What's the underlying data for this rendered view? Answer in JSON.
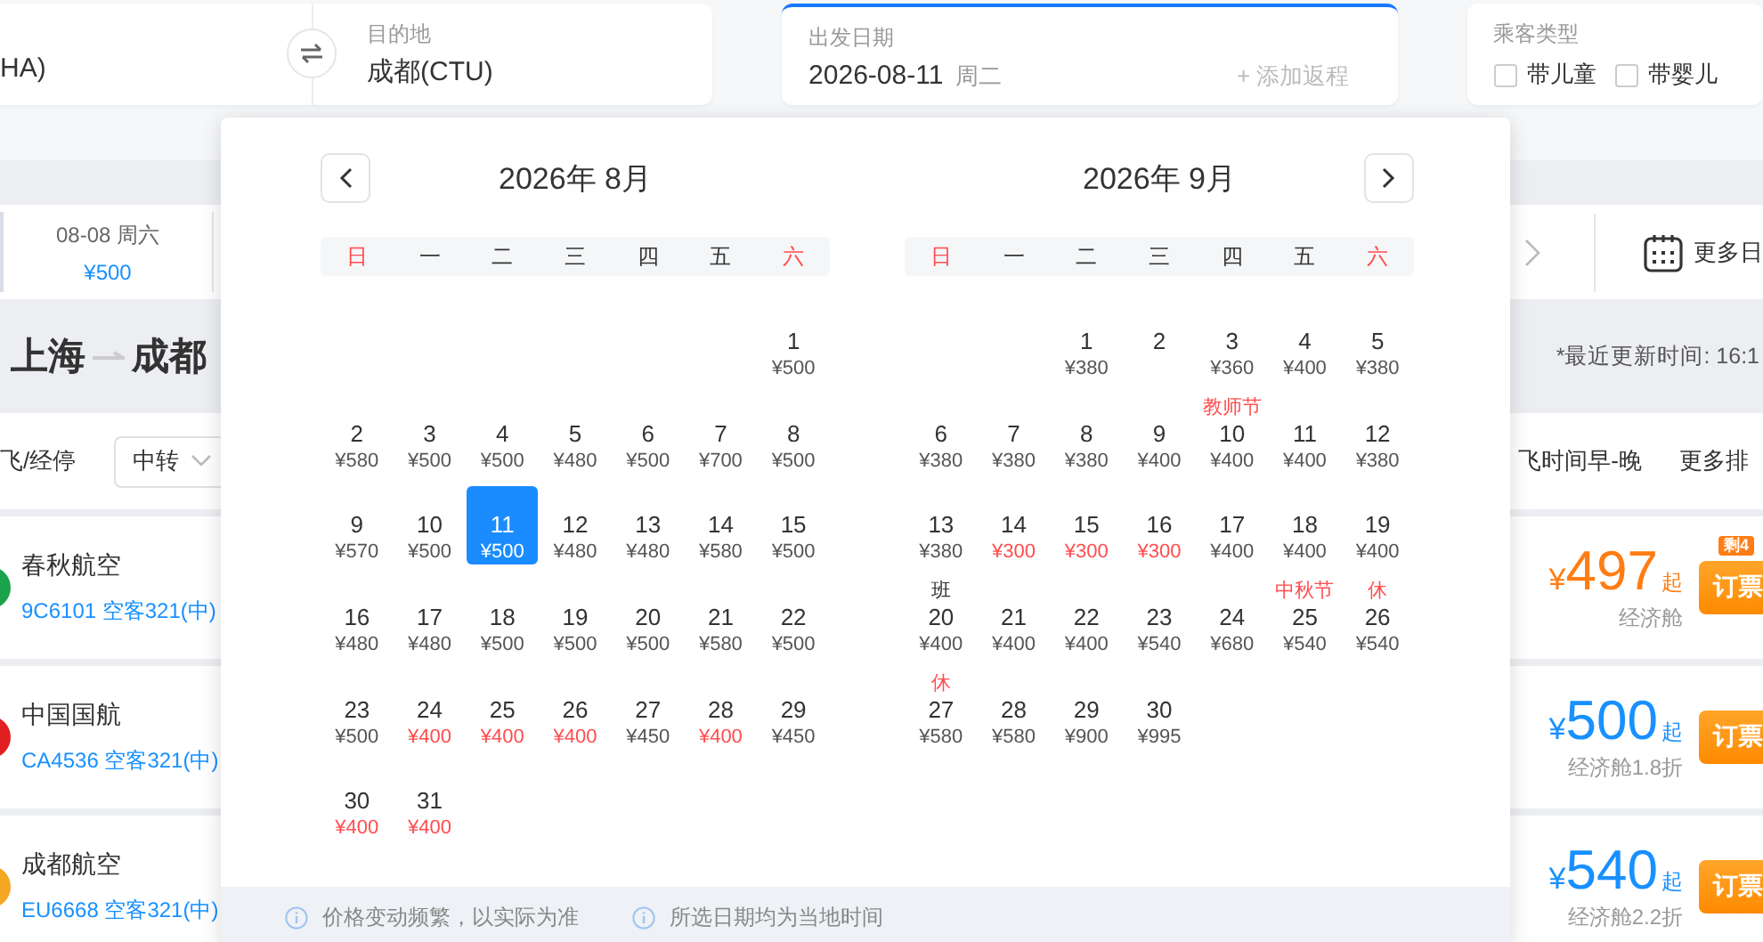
{
  "search": {
    "origin": {
      "value": "HA)"
    },
    "destination": {
      "label": "目的地",
      "value": "成都(CTU)"
    },
    "date": {
      "label": "出发日期",
      "value": "2026-08-11",
      "weekday": "周二",
      "focused": true,
      "add_return": "+ 添加返程"
    },
    "passengers": {
      "label": "乘客类型",
      "options": [
        {
          "label": "带儿童",
          "checked": false
        },
        {
          "label": "带婴儿",
          "checked": false
        }
      ]
    }
  },
  "date_strip": {
    "items": [
      {
        "date": "08-08",
        "weekday": "周六",
        "price": "¥500"
      }
    ],
    "more_dates": "更多日"
  },
  "route": {
    "from": "上海",
    "to": "成都",
    "updated": "*最近更新时间: 16:1"
  },
  "filters": {
    "stops": "飞/经停",
    "transfer": "中转",
    "sort": "飞时间早-晚",
    "more_sort": "更多排"
  },
  "flights": [
    {
      "airline": "春秋航空",
      "color": "#1aa34a",
      "flight": "9C6101 空客321(中)",
      "currency": "¥",
      "price": "497",
      "suffix": "起",
      "cabin": "经济舱",
      "lowest": true,
      "badge": "剩4",
      "book": "订票"
    },
    {
      "airline": "中国国航",
      "color": "#e02020",
      "flight": "CA4536 空客321(中)",
      "currency": "¥",
      "price": "500",
      "suffix": "起",
      "cabin": "经济舱1.8折",
      "lowest": false,
      "book": "订票"
    },
    {
      "airline": "成都航空",
      "color": "#f5a623",
      "flight": "EU6668 空客321(中)",
      "currency": "¥",
      "price": "540",
      "suffix": "起",
      "cabin": "经济舱2.2折",
      "lowest": false,
      "book": "订票"
    }
  ],
  "calendar": {
    "months": [
      {
        "title": "2026年 8月",
        "weekdays": [
          {
            "label": "日",
            "weekend": true
          },
          {
            "label": "一",
            "weekend": false
          },
          {
            "label": "二",
            "weekend": false
          },
          {
            "label": "三",
            "weekend": false
          },
          {
            "label": "四",
            "weekend": false
          },
          {
            "label": "五",
            "weekend": false
          },
          {
            "label": "六",
            "weekend": true
          }
        ],
        "weeks": [
          {
            "first_week": true,
            "days": [
              {
                "day": "1",
                "price": "¥500",
                "low": false,
                "selected": false
              }
            ]
          },
          {
            "days": [
              {
                "day": "2",
                "price": "¥580",
                "low": false,
                "selected": false
              },
              {
                "day": "3",
                "price": "¥500",
                "low": false,
                "selected": false
              },
              {
                "day": "4",
                "price": "¥500",
                "low": false,
                "selected": false
              },
              {
                "day": "5",
                "price": "¥480",
                "low": false,
                "selected": false
              },
              {
                "day": "6",
                "price": "¥500",
                "low": false,
                "selected": false
              },
              {
                "day": "7",
                "price": "¥700",
                "low": false,
                "selected": false
              },
              {
                "day": "8",
                "price": "¥500",
                "low": false,
                "selected": false
              }
            ]
          },
          {
            "days": [
              {
                "day": "9",
                "price": "¥570",
                "low": false,
                "selected": false
              },
              {
                "day": "10",
                "price": "¥500",
                "low": false,
                "selected": false
              },
              {
                "day": "11",
                "price": "¥500",
                "low": false,
                "selected": true
              },
              {
                "day": "12",
                "price": "¥480",
                "low": false,
                "selected": false
              },
              {
                "day": "13",
                "price": "¥480",
                "low": false,
                "selected": false
              },
              {
                "day": "14",
                "price": "¥580",
                "low": false,
                "selected": false
              },
              {
                "day": "15",
                "price": "¥500",
                "low": false,
                "selected": false
              }
            ]
          },
          {
            "days": [
              {
                "day": "16",
                "price": "¥480",
                "low": false,
                "selected": false
              },
              {
                "day": "17",
                "price": "¥480",
                "low": false,
                "selected": false
              },
              {
                "day": "18",
                "price": "¥500",
                "low": false,
                "selected": false
              },
              {
                "day": "19",
                "price": "¥500",
                "low": false,
                "selected": false
              },
              {
                "day": "20",
                "price": "¥500",
                "low": false,
                "selected": false
              },
              {
                "day": "21",
                "price": "¥580",
                "low": false,
                "selected": false
              },
              {
                "day": "22",
                "price": "¥500",
                "low": false,
                "selected": false
              }
            ]
          },
          {
            "days": [
              {
                "day": "23",
                "price": "¥500",
                "low": false,
                "selected": false
              },
              {
                "day": "24",
                "price": "¥400",
                "low": true,
                "selected": false
              },
              {
                "day": "25",
                "price": "¥400",
                "low": true,
                "selected": false
              },
              {
                "day": "26",
                "price": "¥400",
                "low": true,
                "selected": false
              },
              {
                "day": "27",
                "price": "¥450",
                "low": false,
                "selected": false
              },
              {
                "day": "28",
                "price": "¥400",
                "low": true,
                "selected": false
              },
              {
                "day": "29",
                "price": "¥450",
                "low": false,
                "selected": false
              }
            ]
          },
          {
            "first_week": false,
            "days": [
              {
                "day": "30",
                "price": "¥400",
                "low": true,
                "selected": false
              },
              {
                "day": "31",
                "price": "¥400",
                "low": true,
                "selected": false
              }
            ]
          }
        ]
      },
      {
        "title": "2026年 9月",
        "weekdays": [
          {
            "label": "日",
            "weekend": true
          },
          {
            "label": "一",
            "weekend": false
          },
          {
            "label": "二",
            "weekend": false
          },
          {
            "label": "三",
            "weekend": false
          },
          {
            "label": "四",
            "weekend": false
          },
          {
            "label": "五",
            "weekend": false
          },
          {
            "label": "六",
            "weekend": true
          }
        ],
        "weeks": [
          {
            "first_week": true,
            "days": [
              {
                "day": "1",
                "price": "¥380",
                "low": false,
                "selected": false
              },
              {
                "day": "2",
                "selected": false
              },
              {
                "day": "3",
                "price": "¥360",
                "low": false,
                "selected": false
              },
              {
                "day": "4",
                "price": "¥400",
                "low": false,
                "selected": false
              },
              {
                "day": "5",
                "price": "¥380",
                "low": false,
                "selected": false
              }
            ]
          },
          {
            "days": [
              {
                "day": "6",
                "price": "¥380",
                "low": false,
                "selected": false
              },
              {
                "day": "7",
                "price": "¥380",
                "low": false,
                "selected": false
              },
              {
                "day": "8",
                "price": "¥380",
                "low": false,
                "selected": false
              },
              {
                "day": "9",
                "price": "¥400",
                "low": false,
                "selected": false
              },
              {
                "day": "10",
                "price": "¥400",
                "low": false,
                "selected": false,
                "label": "教师节",
                "holiday": true
              },
              {
                "day": "11",
                "price": "¥400",
                "low": false,
                "selected": false
              },
              {
                "day": "12",
                "price": "¥380",
                "low": false,
                "selected": false
              }
            ]
          },
          {
            "days": [
              {
                "day": "13",
                "price": "¥380",
                "low": false,
                "selected": false
              },
              {
                "day": "14",
                "price": "¥300",
                "low": true,
                "selected": false
              },
              {
                "day": "15",
                "price": "¥300",
                "low": true,
                "selected": false
              },
              {
                "day": "16",
                "price": "¥300",
                "low": true,
                "selected": false
              },
              {
                "day": "17",
                "price": "¥400",
                "low": false,
                "selected": false
              },
              {
                "day": "18",
                "price": "¥400",
                "low": false,
                "selected": false
              },
              {
                "day": "19",
                "price": "¥400",
                "low": false,
                "selected": false
              }
            ]
          },
          {
            "days": [
              {
                "day": "20",
                "price": "¥400",
                "low": false,
                "selected": false,
                "label": "班",
                "holiday": false
              },
              {
                "day": "21",
                "price": "¥400",
                "low": false,
                "selected": false
              },
              {
                "day": "22",
                "price": "¥400",
                "low": false,
                "selected": false
              },
              {
                "day": "23",
                "price": "¥540",
                "low": false,
                "selected": false
              },
              {
                "day": "24",
                "price": "¥680",
                "low": false,
                "selected": false
              },
              {
                "day": "25",
                "price": "¥540",
                "low": false,
                "selected": false,
                "label": "中秋节",
                "holiday": true
              },
              {
                "day": "26",
                "price": "¥540",
                "low": false,
                "selected": false,
                "label": "休",
                "holiday": true
              }
            ]
          },
          {
            "first_week": false,
            "days": [
              {
                "day": "27",
                "price": "¥580",
                "low": false,
                "selected": false,
                "label": "休",
                "holiday": true
              },
              {
                "day": "28",
                "price": "¥580",
                "low": false,
                "selected": false
              },
              {
                "day": "29",
                "price": "¥900",
                "low": false,
                "selected": false
              },
              {
                "day": "30",
                "price": "¥995",
                "low": false,
                "selected": false
              }
            ]
          }
        ]
      }
    ],
    "notes": [
      "价格变动频繁，以实际为准",
      "所选日期均为当地时间"
    ]
  }
}
